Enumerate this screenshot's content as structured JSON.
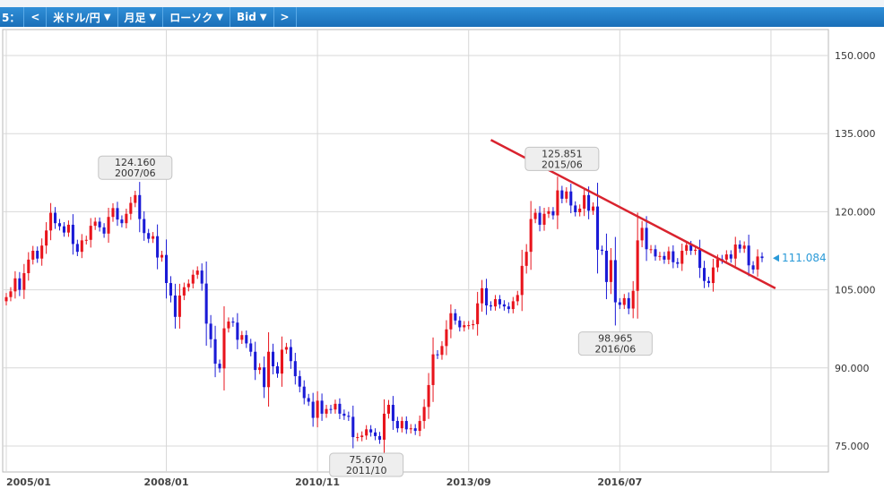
{
  "toolbar": {
    "lead": "5：",
    "prev": "<",
    "pair": "米ドル/円",
    "period": "月足",
    "style": "ローソク",
    "price": "Bid",
    "next": ">"
  },
  "colors": {
    "up": "#e8141c",
    "down": "#1a1ad6",
    "trend": "#d9232e",
    "grid": "#d8d8d8",
    "current": "#2a9ad8"
  },
  "chart_data": {
    "type": "candlestick",
    "x_labels": [
      "2005/01",
      "2008/01",
      "2010/11",
      "2013/09",
      "2016/07"
    ],
    "y_ticks": [
      "150.000",
      "135.000",
      "120.000",
      "105.000",
      "90.000",
      "75.000"
    ],
    "ylim": [
      70.0,
      155.0
    ],
    "current_price": "111.084",
    "annotations": [
      {
        "price": "124.160",
        "date": "2007/06"
      },
      {
        "price": "125.851",
        "date": "2015/06"
      },
      {
        "price": "75.670",
        "date": "2011/10"
      },
      {
        "price": "98.965",
        "date": "2016/06"
      }
    ],
    "trendline": {
      "from": {
        "date": "2014/02",
        "value": 133.8
      },
      "to": {
        "date": "2019/06",
        "value": 105.3
      }
    },
    "months": [
      "2005/01",
      "2005/02",
      "2005/03",
      "2005/04",
      "2005/05",
      "2005/06",
      "2005/07",
      "2005/08",
      "2005/09",
      "2005/10",
      "2005/11",
      "2005/12",
      "2006/01",
      "2006/02",
      "2006/03",
      "2006/04",
      "2006/05",
      "2006/06",
      "2006/07",
      "2006/08",
      "2006/09",
      "2006/10",
      "2006/11",
      "2006/12",
      "2007/01",
      "2007/02",
      "2007/03",
      "2007/04",
      "2007/05",
      "2007/06",
      "2007/07",
      "2007/08",
      "2007/09",
      "2007/10",
      "2007/11",
      "2007/12",
      "2008/01",
      "2008/02",
      "2008/03",
      "2008/04",
      "2008/05",
      "2008/06",
      "2008/07",
      "2008/08",
      "2008/09",
      "2008/10",
      "2008/11",
      "2008/12",
      "2009/01",
      "2009/02",
      "2009/03",
      "2009/04",
      "2009/05",
      "2009/06",
      "2009/07",
      "2009/08",
      "2009/09",
      "2009/10",
      "2009/11",
      "2009/12",
      "2010/01",
      "2010/02",
      "2010/03",
      "2010/04",
      "2010/05",
      "2010/06",
      "2010/07",
      "2010/08",
      "2010/09",
      "2010/10",
      "2010/11",
      "2010/12",
      "2011/01",
      "2011/02",
      "2011/03",
      "2011/04",
      "2011/05",
      "2011/06",
      "2011/07",
      "2011/08",
      "2011/09",
      "2011/10",
      "2011/11",
      "2011/12",
      "2012/01",
      "2012/02",
      "2012/03",
      "2012/04",
      "2012/05",
      "2012/06",
      "2012/07",
      "2012/08",
      "2012/09",
      "2012/10",
      "2012/11",
      "2012/12",
      "2013/01",
      "2013/02",
      "2013/03",
      "2013/04",
      "2013/05",
      "2013/06",
      "2013/07",
      "2013/08",
      "2013/09",
      "2013/10",
      "2013/11",
      "2013/12",
      "2014/01",
      "2014/02",
      "2014/03",
      "2014/04",
      "2014/05",
      "2014/06",
      "2014/07",
      "2014/08",
      "2014/09",
      "2014/10",
      "2014/11",
      "2014/12",
      "2015/01",
      "2015/02",
      "2015/03",
      "2015/04",
      "2015/05",
      "2015/06",
      "2015/07",
      "2015/08",
      "2015/09",
      "2015/10",
      "2015/11",
      "2015/12",
      "2016/01",
      "2016/02",
      "2016/03",
      "2016/04",
      "2016/05",
      "2016/06",
      "2016/07",
      "2016/08",
      "2016/09",
      "2016/10",
      "2016/11",
      "2016/12",
      "2017/01",
      "2017/02",
      "2017/03",
      "2017/04",
      "2017/05",
      "2017/06",
      "2017/07",
      "2017/08",
      "2017/09",
      "2017/10",
      "2017/11",
      "2017/12",
      "2018/01",
      "2018/02",
      "2018/03",
      "2018/04",
      "2018/05",
      "2018/06",
      "2018/07",
      "2018/08",
      "2018/09",
      "2018/10",
      "2018/11",
      "2018/12",
      "2019/01",
      "2019/02",
      "2019/03"
    ],
    "closes": [
      103.6,
      104.7,
      107.2,
      105.0,
      108.2,
      110.8,
      112.5,
      111.0,
      113.5,
      116.4,
      119.8,
      117.8,
      117.2,
      116.0,
      117.5,
      113.8,
      112.3,
      114.5,
      114.6,
      117.3,
      118.1,
      117.0,
      115.8,
      119.0,
      120.7,
      118.5,
      117.8,
      119.6,
      121.7,
      123.2,
      118.6,
      115.9,
      114.8,
      115.3,
      111.2,
      111.7,
      106.3,
      103.9,
      99.8,
      103.9,
      105.5,
      106.2,
      107.9,
      108.7,
      106.2,
      98.5,
      95.5,
      90.8,
      89.9,
      97.6,
      98.9,
      98.7,
      95.4,
      96.3,
      94.7,
      93.1,
      89.6,
      90.1,
      86.3,
      93.1,
      90.3,
      88.9,
      93.5,
      94.0,
      91.3,
      88.4,
      86.4,
      84.2,
      83.5,
      80.4,
      83.7,
      81.2,
      82.1,
      82.0,
      83.1,
      81.2,
      80.8,
      80.6,
      76.7,
      76.7,
      77.0,
      78.2,
      77.6,
      76.9,
      76.2,
      81.2,
      82.9,
      79.8,
      78.4,
      79.8,
      78.2,
      78.4,
      77.9,
      79.8,
      82.5,
      86.7,
      92.6,
      92.5,
      94.2,
      97.4,
      100.5,
      99.1,
      97.8,
      98.2,
      98.2,
      98.4,
      102.4,
      105.3,
      102.0,
      101.8,
      103.2,
      102.2,
      101.8,
      101.3,
      102.8,
      104.0,
      109.6,
      112.3,
      118.6,
      119.8,
      117.5,
      119.6,
      120.1,
      119.3,
      124.1,
      122.5,
      123.9,
      121.2,
      119.9,
      120.6,
      123.2,
      120.2,
      121.0,
      112.7,
      112.5,
      106.5,
      110.7,
      102.6,
      102.1,
      103.4,
      101.4,
      104.8,
      114.5,
      116.9,
      112.8,
      112.8,
      111.4,
      111.5,
      110.8,
      112.4,
      110.3,
      110.0,
      112.5,
      113.6,
      112.5,
      112.7,
      109.2,
      106.7,
      106.3,
      109.3,
      110.9,
      110.8,
      111.8,
      111.0,
      113.7,
      112.9,
      113.5,
      109.7,
      108.9,
      111.4,
      111.1
    ]
  }
}
